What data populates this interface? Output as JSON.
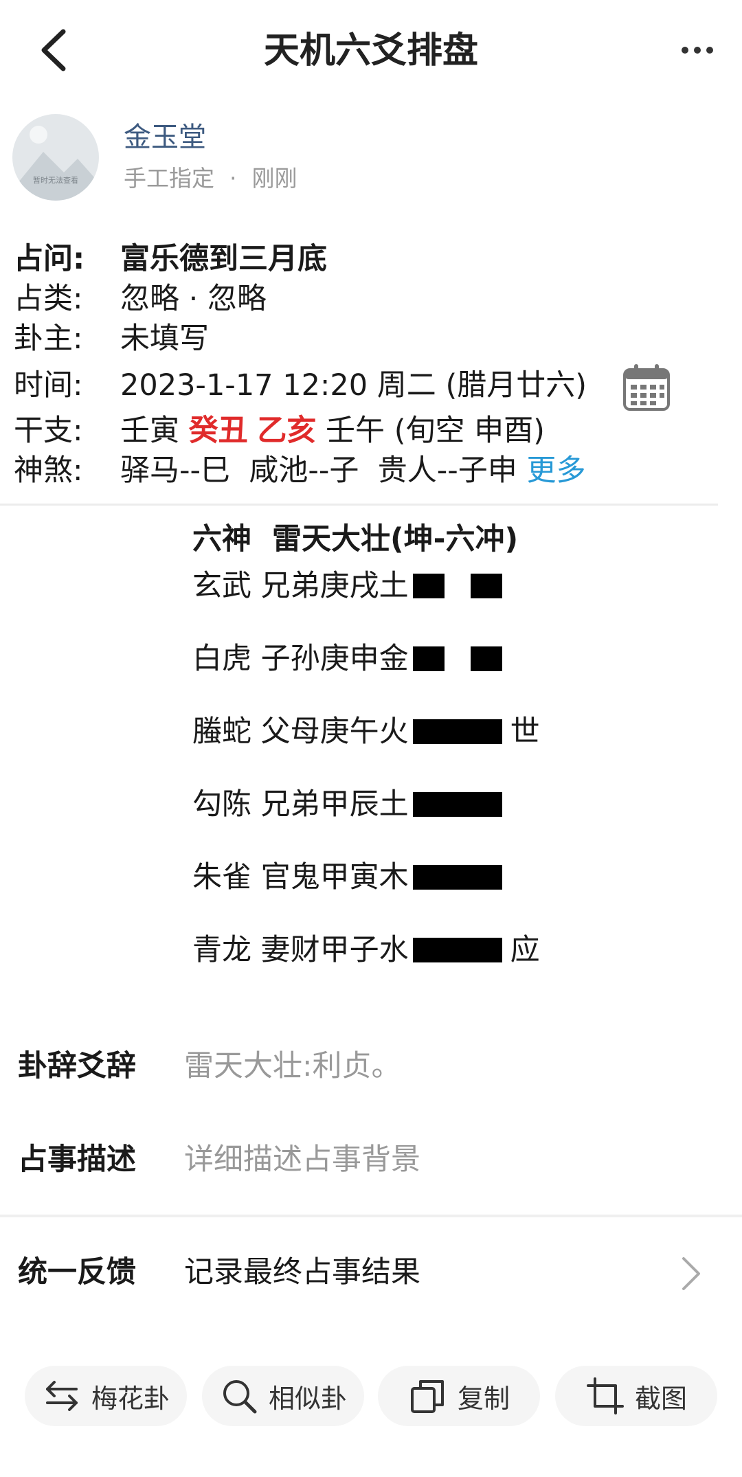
{
  "header": {
    "title": "天机六爻排盘"
  },
  "post": {
    "avatar_text": "暂时无法查看",
    "username": "金玉堂",
    "method": "手工指定",
    "separator": "·",
    "time": "刚刚"
  },
  "info": {
    "question_label": "占问:",
    "question": "富乐德到三月底",
    "category_label": "占类:",
    "category": "忽略 · 忽略",
    "subject_label": "卦主:",
    "subject": "未填写",
    "datetime_label": "时间:",
    "datetime": "2023-1-17 12:20 周二 (腊月廿六)",
    "ganzhi_label": "干支:",
    "ganzhi_year": "壬寅",
    "ganzhi_month": "癸丑",
    "ganzhi_day": "乙亥",
    "ganzhi_hour": "壬午",
    "ganzhi_void": "(旬空 申酉)",
    "shensha_label": "神煞:",
    "shensha": "驿马--巳  咸池--子  贵人--子申",
    "more_label": "更多"
  },
  "hexagram": {
    "header": "六神  雷天大壮(坤-六冲)",
    "lines": [
      {
        "text": "玄武 兄弟庚戌土",
        "yin": true,
        "mark": ""
      },
      {
        "text": "白虎 子孙庚申金",
        "yin": true,
        "mark": ""
      },
      {
        "text": "螣蛇 父母庚午火",
        "yin": false,
        "mark": "世"
      },
      {
        "text": "勾陈 兄弟甲辰土",
        "yin": false,
        "mark": ""
      },
      {
        "text": "朱雀 官鬼甲寅木",
        "yin": false,
        "mark": ""
      },
      {
        "text": "青龙 妻财甲子水",
        "yin": false,
        "mark": "应"
      }
    ]
  },
  "details": {
    "guaci_label": "卦辞爻辞",
    "guaci": "雷天大壮:利贞。",
    "desc_label": "占事描述",
    "desc_placeholder": "详细描述占事背景"
  },
  "feedback": {
    "label": "统一反馈",
    "value": "记录最终占事结果"
  },
  "toolbar": {
    "meihua": "梅花卦",
    "similar": "相似卦",
    "copy": "复制",
    "screenshot": "截图"
  },
  "colors": {
    "accent_blue": "#2799d6",
    "red": "#e02b2b",
    "username": "#3d5a80"
  }
}
